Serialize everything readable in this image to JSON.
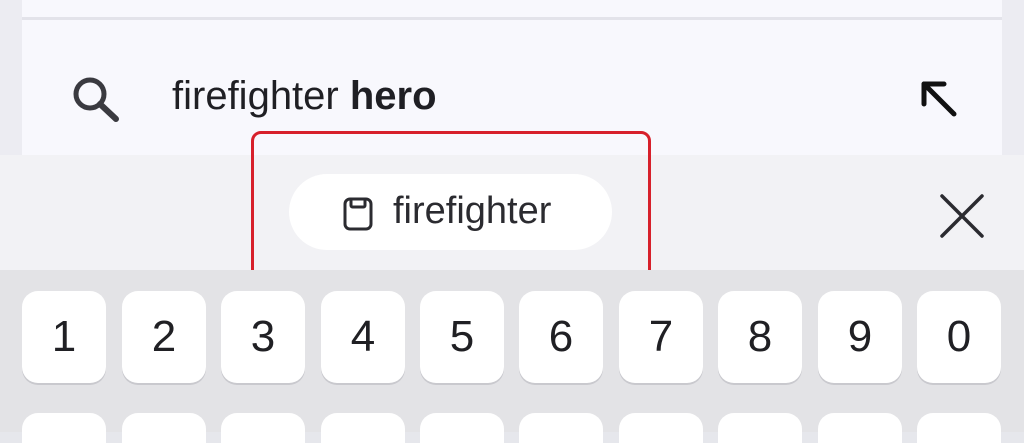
{
  "suggestion": {
    "prefix": "firefighter ",
    "completion": "hero",
    "search_icon": "search-icon",
    "fill_icon": "arrow-up-left-icon"
  },
  "clipboard": {
    "chip_label": "firefighter",
    "icon": "clipboard-icon",
    "close_icon": "close-icon"
  },
  "keyboard": {
    "number_row": [
      "1",
      "2",
      "3",
      "4",
      "5",
      "6",
      "7",
      "8",
      "9",
      "0"
    ]
  },
  "colors": {
    "highlight": "#d7202b",
    "panel": "#f8f8fd",
    "keyboard_bg": "#e3e3e6"
  }
}
